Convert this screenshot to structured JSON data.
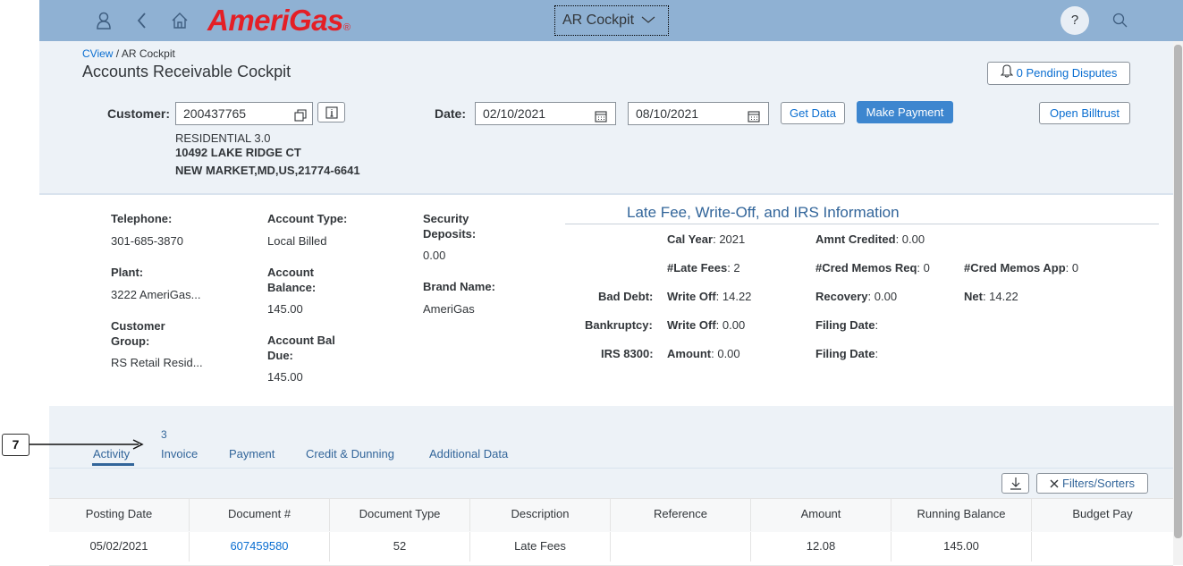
{
  "shell": {
    "logo": "AmeriGas",
    "logo_mark": "®",
    "app_title": "AR Cockpit",
    "help": "?"
  },
  "breadcrumb": {
    "link": "CView",
    "separator": " / ",
    "current": "AR Cockpit"
  },
  "page_title": "Accounts Receivable Cockpit",
  "pending_disputes": "0 Pending Disputes",
  "filters": {
    "customer_label": "Customer:",
    "customer_value": "200437765",
    "date_label": "Date:",
    "date_from": "02/10/2021",
    "date_to": "08/10/2021",
    "get_data": "Get Data",
    "make_payment": "Make Payment",
    "open_billtrust": "Open Billtrust"
  },
  "customer": {
    "line1": "RESIDENTIAL 3.0",
    "line2": "10492 LAKE RIDGE CT",
    "line3": "NEW MARKET,MD,US,21774-6641"
  },
  "info": {
    "telephone_label": "Telephone:",
    "telephone": "301-685-3870",
    "plant_label": "Plant:",
    "plant": "3222 AmeriGas...",
    "customer_group_label1": "Customer",
    "customer_group_label2": "Group:",
    "customer_group": "RS Retail Resid...",
    "account_type_label": "Account Type:",
    "account_type": "Local Billed",
    "account_balance_label1": "Account",
    "account_balance_label2": "Balance:",
    "account_balance": "145.00",
    "account_bal_due_label1": "Account Bal",
    "account_bal_due_label2": "Due:",
    "account_bal_due": "145.00",
    "security_label1": "Security",
    "security_label2": "Deposits:",
    "security": "0.00",
    "brand_label": "Brand Name:",
    "brand": "AmeriGas"
  },
  "late_fee": {
    "title": "Late Fee, Write-Off, and IRS Information",
    "cal_year_label": "Cal Year",
    "cal_year": ": 2021",
    "amnt_credited_label": "Amnt Credited",
    "amnt_credited": ": 0.00",
    "late_fees_label": "#Late Fees",
    "late_fees": ": 2",
    "cred_memos_req_label": "#Cred Memos Req",
    "cred_memos_req": ": 0",
    "cred_memos_app_label": "#Cred Memos App",
    "cred_memos_app": ": 0",
    "bad_debt_label": "Bad Debt:",
    "bad_debt_writeoff_label": "Write Off",
    "bad_debt_writeoff": ": 14.22",
    "recovery_label": "Recovery",
    "recovery": ": 0.00",
    "net_label": "Net",
    "net": ": 14.22",
    "bankruptcy_label": "Bankruptcy:",
    "bankruptcy_writeoff_label": "Write Off",
    "bankruptcy_writeoff": ": 0.00",
    "filing_date_label": "Filing Date",
    "filing_date": ":",
    "irs_label": "IRS 8300:",
    "amount_label": "Amount",
    "amount": ": 0.00",
    "filing_date2_label": "Filing Date",
    "filing_date2": ":"
  },
  "tabs": {
    "activity": "Activity",
    "invoice_count": "3",
    "invoice": "Invoice",
    "payment": "Payment",
    "credit": "Credit & Dunning",
    "additional": "Additional Data"
  },
  "table": {
    "filters_sorters": "Filters/Sorters",
    "columns": [
      "Posting Date",
      "Document #",
      "Document Type",
      "Description",
      "Reference",
      "Amount",
      "Running Balance",
      "Budget Pay"
    ],
    "rows": [
      [
        "05/02/2021",
        "607459580",
        "52",
        "Late Fees",
        "",
        "12.08",
        "145.00",
        ""
      ]
    ]
  },
  "callout": "7"
}
